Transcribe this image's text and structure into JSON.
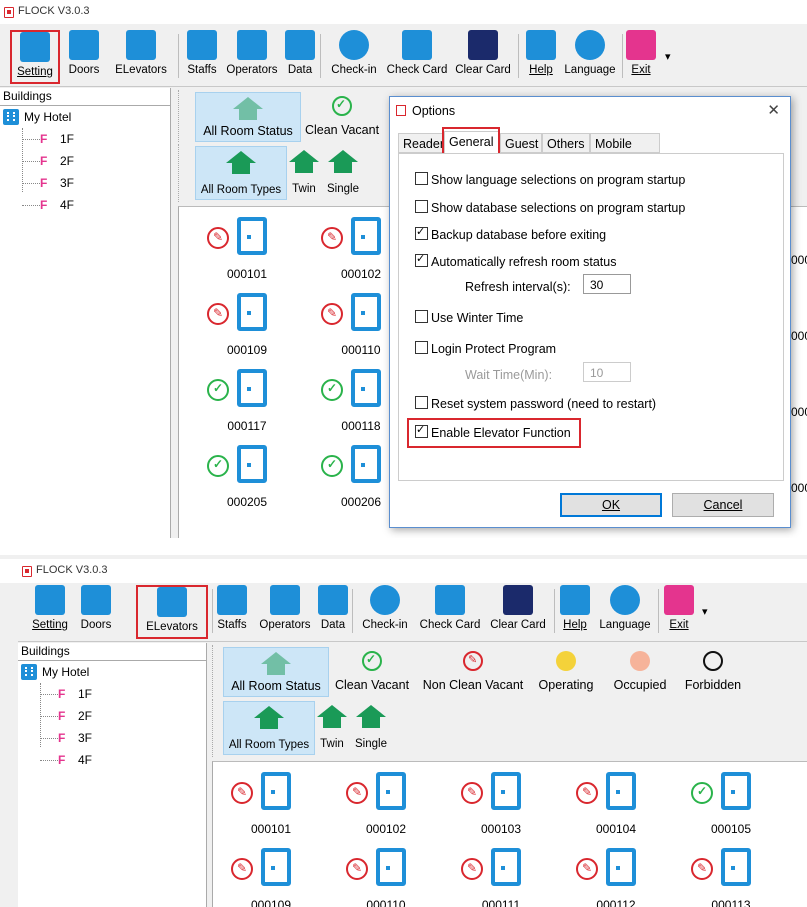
{
  "app_title": "FLOCK V3.0.3",
  "toolbar": {
    "setting": "Setting",
    "doors": "Doors",
    "elevators": "ELevators",
    "staffs": "Staffs",
    "operators": "Operators",
    "data": "Data",
    "checkin": "Check-in",
    "checkcard": "Check Card",
    "clearcard": "Clear Card",
    "help": "Help",
    "language": "Language",
    "exit": "Exit"
  },
  "sidebar": {
    "header": "Buildings",
    "building": "My Hotel",
    "floors": [
      "1F",
      "2F",
      "3F",
      "4F"
    ]
  },
  "status_filters": [
    "All Room Status",
    "Clean Vacant",
    "Non Clean Vacant",
    "Operating",
    "Occupied",
    "Forbidden"
  ],
  "type_filters": [
    "All Room Types",
    "Twin",
    "Single"
  ],
  "rooms_top": [
    {
      "no": "000101",
      "st": "cl"
    },
    {
      "no": "000102",
      "st": "cl"
    },
    {
      "no": "000109",
      "st": "cl"
    },
    {
      "no": "000110",
      "st": "cl"
    },
    {
      "no": "000117",
      "st": "ok"
    },
    {
      "no": "000118",
      "st": "ok"
    },
    {
      "no": "000205",
      "st": "ok"
    },
    {
      "no": "000206",
      "st": "ok"
    }
  ],
  "rooms_top_right_partial": [
    "000",
    "000",
    "000",
    "000",
    "000"
  ],
  "rooms_bottom": [
    {
      "no": "000101",
      "st": "cl"
    },
    {
      "no": "000102",
      "st": "cl"
    },
    {
      "no": "000103",
      "st": "cl"
    },
    {
      "no": "000104",
      "st": "cl"
    },
    {
      "no": "000105",
      "st": "ok"
    },
    {
      "no": "000109",
      "st": "cl"
    },
    {
      "no": "000110",
      "st": "cl"
    },
    {
      "no": "000111",
      "st": "cl"
    },
    {
      "no": "000112",
      "st": "cl"
    },
    {
      "no": "000113",
      "st": "cl"
    }
  ],
  "dialog": {
    "title": "Options",
    "tabs": [
      "Reader",
      "General",
      "Guest",
      "Others",
      "Mobile Key"
    ],
    "options": [
      {
        "label": "Show language selections on program startup",
        "checked": false
      },
      {
        "label": "Show database selections on program startup",
        "checked": false
      },
      {
        "label": "Backup database before exiting",
        "checked": true
      },
      {
        "label": "Automatically refresh room status",
        "checked": true
      },
      {
        "label": "Use Winter Time",
        "checked": false
      },
      {
        "label": "Login Protect Program",
        "checked": false
      },
      {
        "label": "Reset system password (need to restart)",
        "checked": false
      },
      {
        "label": "Enable Elevator Function",
        "checked": true
      }
    ],
    "refresh_label": "Refresh interval(s):",
    "refresh_value": "30",
    "wait_label": "Wait Time(Min):",
    "wait_value": "10",
    "ok": "OK",
    "cancel": "Cancel"
  }
}
